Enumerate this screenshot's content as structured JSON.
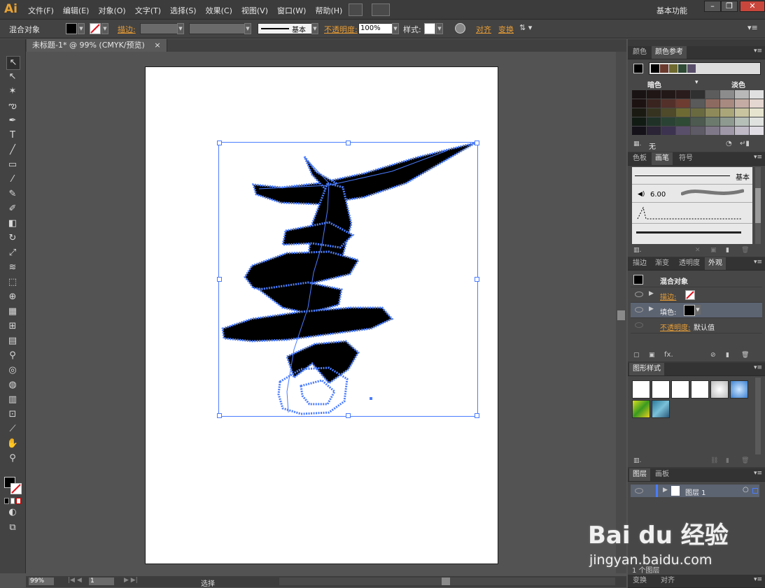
{
  "app": {
    "logo": "Ai"
  },
  "menu": [
    "文件(F)",
    "编辑(E)",
    "对象(O)",
    "文字(T)",
    "选择(S)",
    "效果(C)",
    "视图(V)",
    "窗口(W)",
    "帮助(H)"
  ],
  "workspace": "基本功能",
  "window_buttons": {
    "min": "–",
    "restore": "❐",
    "close": "✕"
  },
  "control": {
    "object_type": "混合对象",
    "stroke_label": "描边:",
    "brush_label": "基本",
    "opacity_label": "不透明度:",
    "opacity_value": "100%",
    "style_label": "样式:",
    "align_label": "对齐",
    "transform_label": "变换"
  },
  "document": {
    "tab_title": "未标题-1* @ 99% (CMYK/预览)",
    "tab_close": "×"
  },
  "status": {
    "zoom": "99%",
    "artboard": "1",
    "tool": "选择"
  },
  "panels": {
    "color_tabs": [
      "颜色",
      "颜色参考"
    ],
    "color_dark": "暗色",
    "color_light": "淡色",
    "color_footer_none": "无",
    "brush_tabs": [
      "色板",
      "画笔",
      "符号"
    ],
    "brush_basic": "基本",
    "brush_size": "6.00",
    "appearance_tabs": [
      "描边",
      "渐变",
      "透明度",
      "外观"
    ],
    "appearance_title": "混合对象",
    "stroke_row": "描边:",
    "fill_row": "填色:",
    "opacity_row": "不透明度:",
    "opacity_row_value": "默认值",
    "styles_tab": "图形样式",
    "layers_tabs": [
      "图层",
      "画板"
    ],
    "layer_name": "图层 1",
    "layer_count": "1 个图层",
    "bottom_tabs": [
      "变换",
      "对齐"
    ]
  },
  "watermark": {
    "brand": "Bai du 经验",
    "url": "jingyan.baidu.com"
  },
  "colors": {
    "accent_orange": "#e89d35",
    "selection_blue": "#4a7cff",
    "menubar": "#3c3c3c",
    "canvas": "#535353"
  }
}
